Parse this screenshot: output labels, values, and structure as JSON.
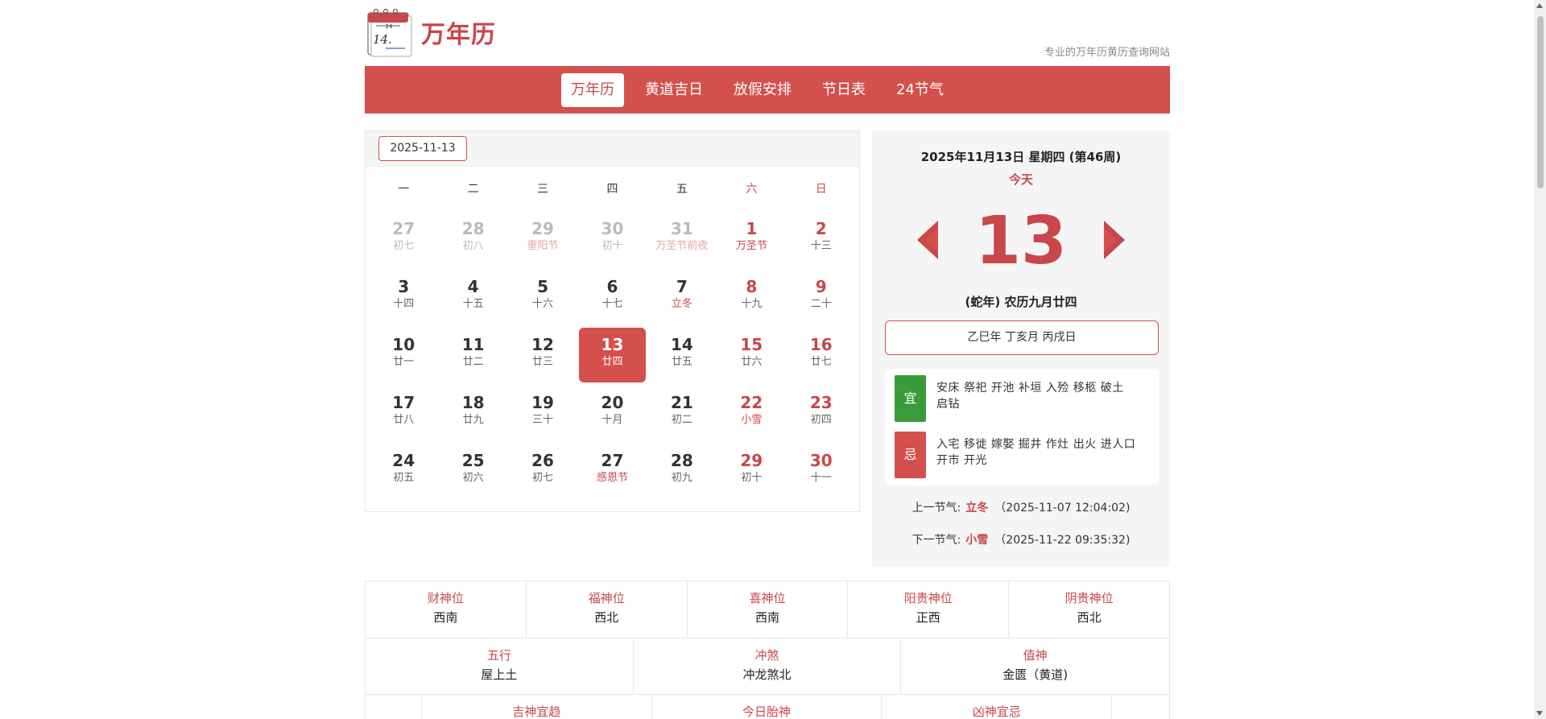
{
  "header": {
    "logo_day": "14.",
    "title": "万年历",
    "slogan": "专业的万年历黄历查询网站"
  },
  "nav": {
    "items": [
      {
        "label": "万年历",
        "active": true
      },
      {
        "label": "黄道吉日",
        "active": false
      },
      {
        "label": "放假安排",
        "active": false
      },
      {
        "label": "节日表",
        "active": false
      },
      {
        "label": "24节气",
        "active": false
      }
    ]
  },
  "calendar": {
    "date_input": "2025-11-13",
    "weekdays": [
      "一",
      "二",
      "三",
      "四",
      "五",
      "六",
      "日"
    ],
    "weeks": [
      [
        {
          "d": "27",
          "l": "初七",
          "other": true
        },
        {
          "d": "28",
          "l": "初八",
          "other": true
        },
        {
          "d": "29",
          "l": "重阳节",
          "other": true,
          "fest": true
        },
        {
          "d": "30",
          "l": "初十",
          "other": true
        },
        {
          "d": "31",
          "l": "万圣节前夜",
          "other": true,
          "fest": true
        },
        {
          "d": "1",
          "l": "万圣节",
          "weekend": true,
          "fest": true
        },
        {
          "d": "2",
          "l": "十三",
          "weekend": true
        }
      ],
      [
        {
          "d": "3",
          "l": "十四"
        },
        {
          "d": "4",
          "l": "十五"
        },
        {
          "d": "5",
          "l": "十六"
        },
        {
          "d": "6",
          "l": "十七"
        },
        {
          "d": "7",
          "l": "立冬",
          "fest": true
        },
        {
          "d": "8",
          "l": "十九",
          "weekend": true
        },
        {
          "d": "9",
          "l": "二十",
          "weekend": true
        }
      ],
      [
        {
          "d": "10",
          "l": "廿一"
        },
        {
          "d": "11",
          "l": "廿二"
        },
        {
          "d": "12",
          "l": "廿三"
        },
        {
          "d": "13",
          "l": "廿四",
          "today": true
        },
        {
          "d": "14",
          "l": "廿五"
        },
        {
          "d": "15",
          "l": "廿六",
          "weekend": true
        },
        {
          "d": "16",
          "l": "廿七",
          "weekend": true
        }
      ],
      [
        {
          "d": "17",
          "l": "廿八"
        },
        {
          "d": "18",
          "l": "廿九"
        },
        {
          "d": "19",
          "l": "三十"
        },
        {
          "d": "20",
          "l": "十月"
        },
        {
          "d": "21",
          "l": "初二"
        },
        {
          "d": "22",
          "l": "小雪",
          "weekend": true,
          "fest": true
        },
        {
          "d": "23",
          "l": "初四",
          "weekend": true
        }
      ],
      [
        {
          "d": "24",
          "l": "初五"
        },
        {
          "d": "25",
          "l": "初六"
        },
        {
          "d": "26",
          "l": "初七"
        },
        {
          "d": "27",
          "l": "感恩节",
          "fest": true
        },
        {
          "d": "28",
          "l": "初九"
        },
        {
          "d": "29",
          "l": "初十",
          "weekend": true
        },
        {
          "d": "30",
          "l": "十一",
          "weekend": true
        }
      ]
    ]
  },
  "panel": {
    "full_date": "2025年11月13日 星期四 (第46周)",
    "today_label": "今天",
    "big_day": "13",
    "lunar": "(蛇年) 农历九月廿四",
    "ganzhi": "乙巳年 丁亥月 丙戌日",
    "yi_label": "宜",
    "yi_text": "安床 祭祀 开池 补垣 入殓 移柩 破土 启钻",
    "ji_label": "忌",
    "ji_text": "入宅 移徙 嫁娶 掘井 作灶 出火 进人口 开市 开光",
    "prev_jieqi": {
      "label": "上一节气:",
      "name": "立冬",
      "time": "（2025-11-07 12:04:02)"
    },
    "next_jieqi": {
      "label": "下一节气:",
      "name": "小雪",
      "time": "（2025-11-22 09:35:32)"
    }
  },
  "table": {
    "row1": [
      {
        "label": "财神位",
        "value": "西南"
      },
      {
        "label": "福神位",
        "value": "西北"
      },
      {
        "label": "喜神位",
        "value": "西南"
      },
      {
        "label": "阳贵神位",
        "value": "正西"
      },
      {
        "label": "阴贵神位",
        "value": "西北"
      }
    ],
    "row2": [
      {
        "label": "五行",
        "value": "屋上土"
      },
      {
        "label": "冲煞",
        "value": "冲龙煞北"
      },
      {
        "label": "值神",
        "value": "金匮（黄道)"
      }
    ],
    "row3": [
      {
        "label": "",
        "value": ""
      },
      {
        "label": "吉神宜趋",
        "value": ""
      },
      {
        "label": "今日胎神",
        "value": ""
      },
      {
        "label": "凶神宜忌",
        "value": ""
      },
      {
        "label": "",
        "value": ""
      }
    ]
  },
  "colors": {
    "brand": "#d4504c",
    "yi": "#3a9b3a",
    "ji": "#d4504c"
  }
}
